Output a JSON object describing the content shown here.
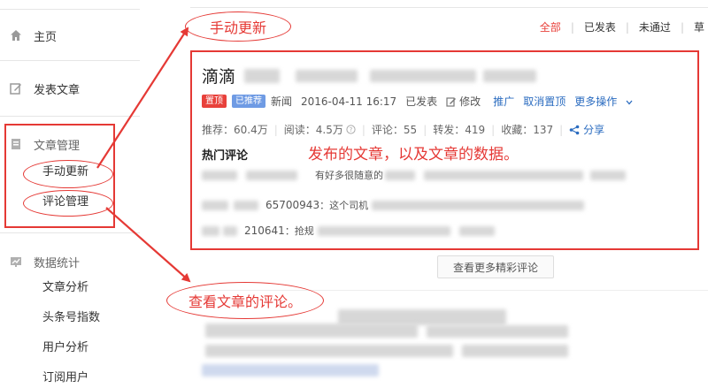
{
  "sidebar": {
    "home": "主页",
    "publish": "发表文章",
    "article_manage": "文章管理",
    "manual_update": "手动更新",
    "comment_manage": "评论管理",
    "stats_section": "数据统计",
    "stats_items": [
      "文章分析",
      "头条号指数",
      "用户分析",
      "订阅用户"
    ]
  },
  "filters": {
    "all": "全部",
    "published": "已发表",
    "rejected": "未通过",
    "draft_partial": "草"
  },
  "article": {
    "title_prefix": "滴滴",
    "badge_top": "置顶",
    "badge_recommended": "已推荐",
    "category": "新闻",
    "date": "2016-04-11 16:17",
    "status": "已发表",
    "edit": "修改",
    "promote": "推广",
    "unpin": "取消置顶",
    "more_actions": "更多操作",
    "stats": {
      "recommend": "推荐：60.4万",
      "read": "阅读：4.5万",
      "comments": "评论：55",
      "reposts": "转发：419",
      "favorites": "收藏：137",
      "share": "分享"
    },
    "hot_comments_label": "热门评论",
    "comments": [
      {
        "text": "有好多很随意的"
      },
      {
        "id": "65700943",
        "text": "：这个司机"
      },
      {
        "id": "210641",
        "text": "：抢规"
      }
    ],
    "more_comments_button": "查看更多精彩评论"
  },
  "annotations": {
    "manual_update": "手动更新",
    "card_note": "发布的文章，以及文章的数据。",
    "comments_note": "查看文章的评论。"
  },
  "colors": {
    "accent_red": "#e53935",
    "link_blue": "#2b6cc0",
    "active_tab": "#e8413b"
  }
}
